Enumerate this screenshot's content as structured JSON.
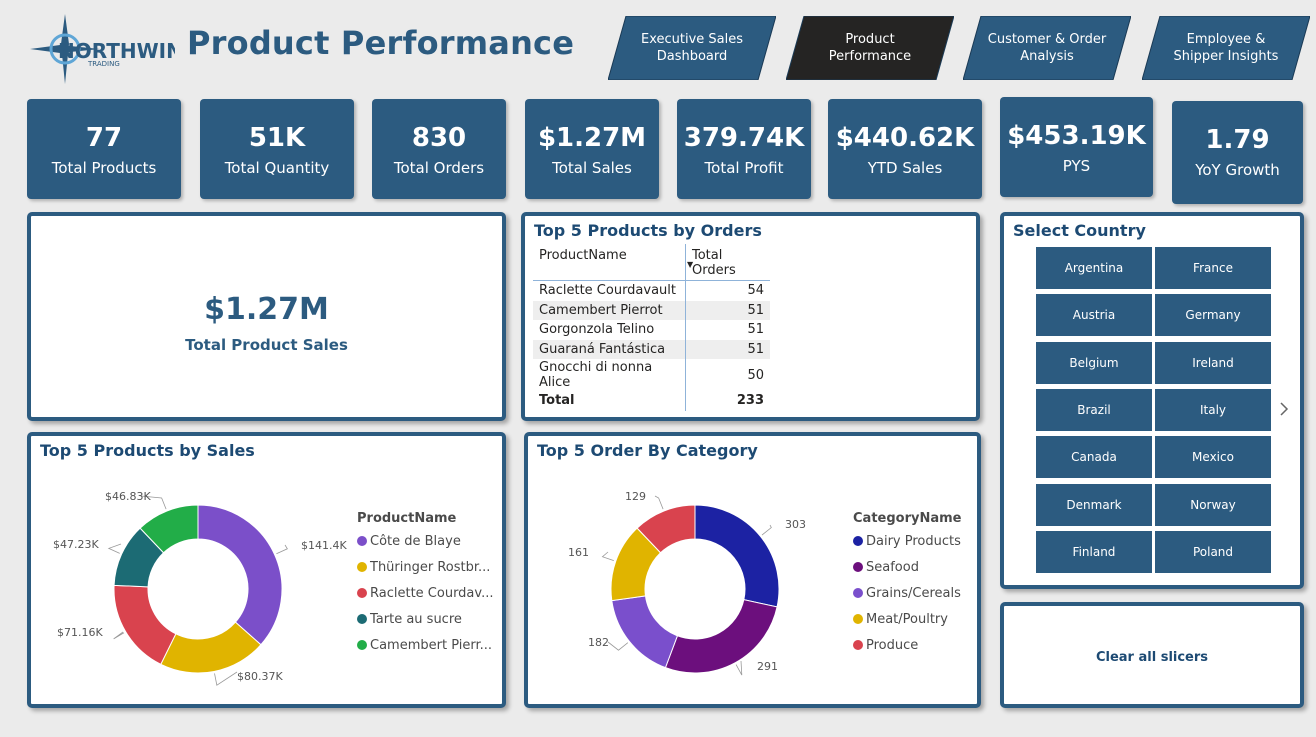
{
  "header": {
    "logo_text": "NORTHWIND",
    "logo_sub": "TRADING",
    "title": "Product Performance",
    "nav": [
      {
        "label": "Executive Sales Dashboard",
        "active": false
      },
      {
        "label": "Product Performance",
        "active": true
      },
      {
        "label": "Customer & Order Analysis",
        "active": false
      },
      {
        "label": "Employee & Shipper Insights",
        "active": false
      }
    ]
  },
  "kpis": [
    {
      "value": "77",
      "label": "Total Products"
    },
    {
      "value": "51K",
      "label": "Total Quantity"
    },
    {
      "value": "830",
      "label": "Total Orders"
    },
    {
      "value": "$1.27M",
      "label": "Total Sales"
    },
    {
      "value": "379.74K",
      "label": "Total Profit"
    },
    {
      "value": "$440.62K",
      "label": "YTD Sales"
    },
    {
      "value": "$453.19K",
      "label": "PYS"
    },
    {
      "value": "1.79",
      "label": "YoY Growth"
    }
  ],
  "card": {
    "value": "$1.27M",
    "label": "Total Product Sales"
  },
  "top_orders": {
    "title": "Top 5 Products by Orders",
    "columns": [
      "ProductName",
      "Total Orders"
    ],
    "rows": [
      {
        "name": "Raclette Courdavault",
        "orders": "54"
      },
      {
        "name": "Camembert Pierrot",
        "orders": "51"
      },
      {
        "name": "Gorgonzola Telino",
        "orders": "51"
      },
      {
        "name": "Guaraná Fantástica",
        "orders": "51"
      },
      {
        "name": "Gnocchi di nonna Alice",
        "orders": "50"
      }
    ],
    "total_label": "Total",
    "total_value": "233"
  },
  "slicer": {
    "title": "Select Country",
    "countries": [
      "Argentina",
      "France",
      "Austria",
      "Germany",
      "Belgium",
      "Ireland",
      "Brazil",
      "Italy",
      "Canada",
      "Mexico",
      "Denmark",
      "Norway",
      "Finland",
      "Poland"
    ],
    "next_icon": "chevron-right-icon"
  },
  "clear_label": "Clear all slicers",
  "colors": {
    "primary": "#2c5b80",
    "active_nav": "#252423"
  },
  "chart_data": [
    {
      "type": "pie",
      "title": "Top 5 Products by Sales",
      "legend_title": "ProductName",
      "categories": [
        "Côte de Blaye",
        "Thüringer Rostbr...",
        "Raclette Courdav...",
        "Tarte au sucre",
        "Camembert Pierr..."
      ],
      "values": [
        141400,
        80370,
        71160,
        47230,
        46830
      ],
      "data_labels": [
        "$141.4K",
        "$80.37K",
        "$71.16K",
        "$47.23K",
        "$46.83K"
      ],
      "colors": [
        "#7b4fc9",
        "#e0b400",
        "#d9434e",
        "#1c6b74",
        "#22ad48"
      ]
    },
    {
      "type": "pie",
      "title": "Top 5 Order By Category",
      "legend_title": "CategoryName",
      "categories": [
        "Dairy Products",
        "Seafood",
        "Grains/Cereals",
        "Meat/Poultry",
        "Produce"
      ],
      "values": [
        303,
        291,
        182,
        161,
        129
      ],
      "data_labels": [
        "303",
        "291",
        "182",
        "161",
        "129"
      ],
      "colors": [
        "#1c22a3",
        "#6c0f7d",
        "#7a4fcc",
        "#e0b400",
        "#d9434e"
      ]
    }
  ]
}
